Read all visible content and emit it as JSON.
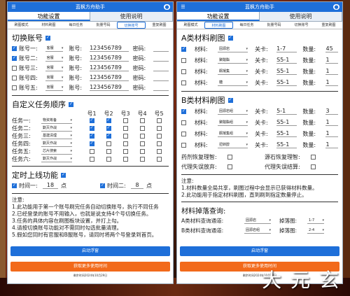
{
  "app_title": "蓝枫方舟助手",
  "main_tabs": [
    "功能设置",
    "使用说明"
  ],
  "left": {
    "sub_tabs": [
      "刷图模式",
      "材料刷图",
      "每日任务",
      "批量号码",
      "切换账号",
      "重复刷图"
    ],
    "switch_section": {
      "title": "切换账号",
      "accounts": [
        {
          "label": "账号一:",
          "checked": true,
          "select": "客服",
          "acct_label": "账号:",
          "acct": "123456789",
          "pwd_label": "密码:"
        },
        {
          "label": "账号二:",
          "checked": true,
          "select": "官服",
          "acct_label": "账号:",
          "acct": "123456789",
          "pwd_label": "密码:"
        },
        {
          "label": "账号三:",
          "checked": false,
          "select": "官服",
          "acct_label": "账号:",
          "acct": "123456789",
          "pwd_label": "密码:"
        },
        {
          "label": "账号四:",
          "checked": false,
          "select": "官服",
          "acct_label": "账号:",
          "acct": "123456789",
          "pwd_label": "密码:"
        },
        {
          "label": "账号五:",
          "checked": false,
          "select": "官服",
          "acct_label": "账号:",
          "acct": "123456789",
          "pwd_label": "密码:"
        }
      ]
    },
    "task_section": {
      "title": "自定义任务顺序",
      "headers": [
        "号1",
        "号2",
        "号3",
        "号4",
        "号5"
      ],
      "tasks": [
        {
          "label": "任务一:",
          "select": "物资筹备",
          "checks": [
            true,
            true,
            false,
            false,
            false
          ]
        },
        {
          "label": "任务二:",
          "select": "剿灭作战",
          "checks": [
            true,
            true,
            false,
            false,
            false
          ]
        },
        {
          "label": "任务三:",
          "select": "基建清理",
          "checks": [
            true,
            true,
            false,
            false,
            false
          ]
        },
        {
          "label": "任务四:",
          "select": "剿灭作战",
          "checks": [
            true,
            false,
            false,
            false,
            false
          ]
        },
        {
          "label": "任务五:",
          "select": "芯片搜索",
          "checks": [
            false,
            false,
            false,
            false,
            false
          ]
        },
        {
          "label": "任务六:",
          "select": "剿灭作战",
          "checks": [
            false,
            false,
            false,
            false,
            false
          ]
        }
      ]
    },
    "timer_section": {
      "title": "定时上线功能",
      "time1_label": "时间一:",
      "time1_value": "18",
      "time1_unit": "点",
      "time2_label": "时间二:",
      "time2_value": "8",
      "time2_unit": "点"
    },
    "notes_title": "注意:",
    "notes": [
      "1.此功能用于第一个账号刷完任务自动切换账号，执行不同任务",
      "2.已经登录的账号不用输入，也就是说支持4个号切换任务。",
      "3.任务的具体内容在刷图板块设置，并打上勾。",
      "4.请按切换账号功能对不需同时勾选批量清理。",
      "5.假如您同时有官服和B服账号，请同时将两个号登录到首页。"
    ],
    "start_button": "启动浮窗",
    "more_button": "获取更多使用时间",
    "expire_text": "剩余时间2024年10月29日"
  },
  "right": {
    "sub_tabs": [
      "刷图模式",
      "材料刷图",
      "每日任务",
      "批量号码",
      "切换账号",
      "重复刷图"
    ],
    "a_section": {
      "title": "A类材料刷图",
      "rows": [
        {
          "checked": true,
          "label": "材料:",
          "select": "固源岩",
          "stage_label": "关卡:",
          "stage": "1-7",
          "qty_label": "数量:",
          "qty": "45"
        },
        {
          "checked": false,
          "label": "材料:",
          "select": "聚酸酯",
          "stage_label": "关卡:",
          "stage": "S5-1",
          "qty_label": "数量:",
          "qty": "1"
        },
        {
          "checked": false,
          "label": "材料:",
          "select": "酮凝集",
          "stage_label": "关卡:",
          "stage": "S5-1",
          "qty_label": "数量:",
          "qty": "1"
        },
        {
          "checked": false,
          "label": "材料:",
          "select": "糖",
          "stage_label": "关卡:",
          "stage": "S5-1",
          "qty_label": "数量:",
          "qty": "1"
        }
      ]
    },
    "b_section": {
      "title": "B类材料刷图",
      "rows": [
        {
          "checked": true,
          "label": "材料:",
          "select": "固源岩组",
          "stage_label": "关卡:",
          "stage": "5-1",
          "qty_label": "数量:",
          "qty": "3"
        },
        {
          "checked": false,
          "label": "材料:",
          "select": "聚酸酯组",
          "stage_label": "关卡:",
          "stage": "S5-1",
          "qty_label": "数量:",
          "qty": "1"
        },
        {
          "checked": false,
          "label": "材料:",
          "select": "酮凝集组",
          "stage_label": "关卡:",
          "stage": "S5-1",
          "qty_label": "数量:",
          "qty": "1"
        },
        {
          "checked": false,
          "label": "材料:",
          "select": "扭转醇",
          "stage_label": "关卡:",
          "stage": "S5-1",
          "qty_label": "数量:",
          "qty": "1"
        }
      ]
    },
    "options": [
      {
        "label": "药剂恢复理智:",
        "checked": false
      },
      {
        "label": "源石恢复理智:",
        "checked": false
      },
      {
        "label": "代理失误放弃:",
        "checked": false
      },
      {
        "label": "代理失误结算:",
        "checked": false
      }
    ],
    "notes_title": "注意:",
    "notes": [
      "1.材料数量全局共享，刷图过程中会显示已获得材料数量。",
      "2.此功能用于指定材料刷图，直到刷到指定数量停止。"
    ],
    "query_section": {
      "title": "材料掉落查询:",
      "a_label": "A类材料查询通道:",
      "a_select": "固源岩",
      "a_drop_label": "掉落图:",
      "a_drop": "1-7",
      "b_label": "B类材料查询通道:",
      "b_select": "固源岩组",
      "b_drop_label": "掉落图:",
      "b_drop": "2-4"
    },
    "start_button": "启动浮窗",
    "more_button": "获取更多使用时间",
    "expire_text": "剩余时间2024年10月29日"
  },
  "watermark": "大 元 玄"
}
